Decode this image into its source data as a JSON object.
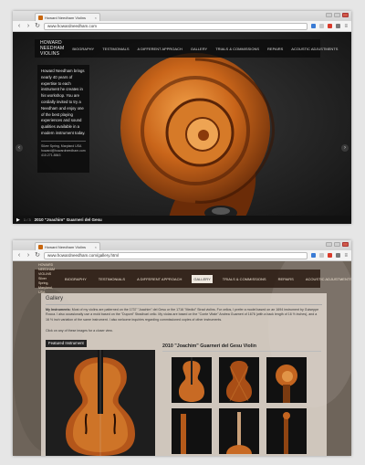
{
  "windows": [
    {
      "tab_title": "Howard Needham Violins",
      "url": "www.howardneedham.com"
    },
    {
      "tab_title": "Howard Needham Violins",
      "url": "www.howardneedham.com/gallery.html"
    }
  ],
  "site": {
    "logo": "HOWARD NEEDHAM VIOLINS",
    "nav": [
      "BIOGRAPHY",
      "TESTIMONIALS",
      "A DIFFERENT APPROACH",
      "GALLERY",
      "TRIALS & COMMISSIONS",
      "REPAIRS",
      "ACOUSTIC ADJUSTMENTS"
    ]
  },
  "home": {
    "intro": "Howard Needham brings nearly 40 years of expertise to each instrument he creates in his workshop. You are cordially invited to try a Needham and enjoy one of the best playing experiences and sound qualities available in a modern instrument today.",
    "contact": [
      "Silver Spring, Maryland USA",
      "howard@howardneedham.com",
      "410.271.8843"
    ],
    "slide_counter": "1 / 3",
    "caption": "2010 \"Joachim\" Guarneri del Gesu"
  },
  "gallery": {
    "title": "Gallery",
    "intro_label": "My Instruments:",
    "intro_text": "Most of my violins are patterned on the 1737 \"Joachim\" del Gesu or the 1716 \"Medici\" Strad violins. For cellos, I prefer a model based on an 1694 instrument by Guiseppe Rocca. I also occasionally use a mold based on the \"Dupont\" Stradivari cello. My violas are based on the \"Conte Vitale\" Andrea Guarneri of 1676 (with a back length of 16 ½ inches), and a 16 ½ inch variation of the same instrument. I also welcome inquiries regarding commissioned copies of other instruments.",
    "intro_more": "Click on any of these images for a closer view.",
    "featured_label": "Featured Instrument",
    "instrument_title": "2010 \"Joachim\" Guarneri del Gesu Violin",
    "logo_lines": [
      "HOWARD NEEDHAM VIOLINS",
      "Silver Spring, Maryland, USA",
      "howard@howardneedham.com",
      "410.271.8843"
    ]
  }
}
